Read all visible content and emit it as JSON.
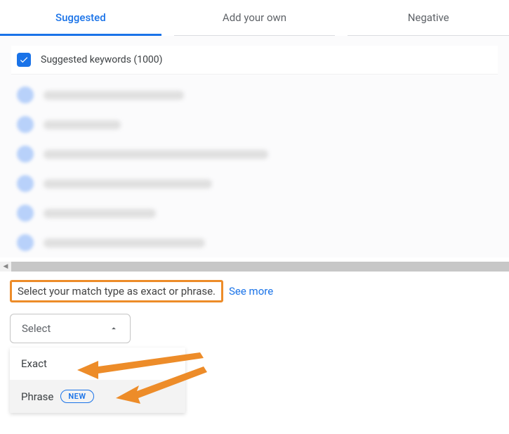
{
  "tabs": {
    "suggested": "Suggested",
    "add_your_own": "Add your own",
    "negative": "Negative"
  },
  "header": {
    "label": "Suggested keywords (1000)"
  },
  "instruction": {
    "text": "Select your match type as exact or phrase.",
    "see_more": "See more"
  },
  "select": {
    "placeholder": "Select"
  },
  "dropdown": {
    "exact": "Exact",
    "phrase": "Phrase",
    "new_badge": "NEW"
  }
}
